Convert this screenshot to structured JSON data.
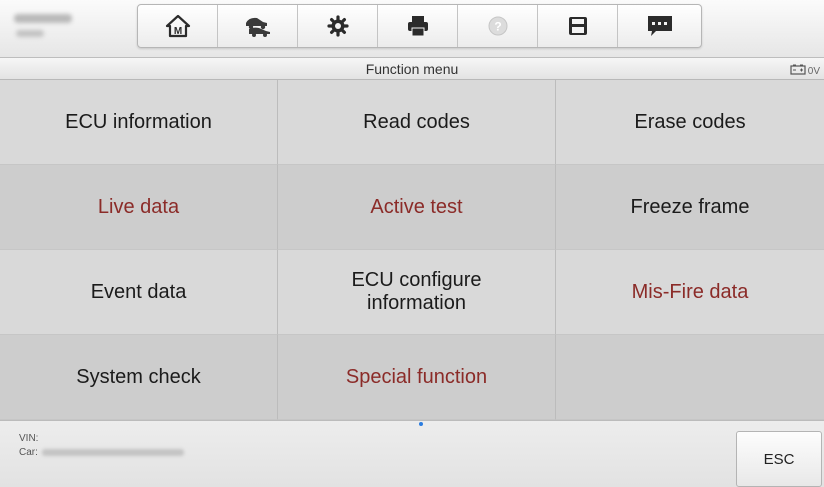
{
  "toolbar": {
    "icons": [
      "home-icon",
      "vehicle-swap-icon",
      "settings-gear-icon",
      "printer-icon",
      "help-icon",
      "save-icon",
      "message-icon"
    ]
  },
  "function_bar": {
    "title": "Function menu",
    "battery_voltage": "0V"
  },
  "menu": {
    "items": [
      {
        "label": "ECU information",
        "color": "#1b1b1b"
      },
      {
        "label": "Read codes",
        "color": "#1b1b1b"
      },
      {
        "label": "Erase codes",
        "color": "#1b1b1b"
      },
      {
        "label": "Live data",
        "color": "#8b2b28"
      },
      {
        "label": "Active test",
        "color": "#8b2b28"
      },
      {
        "label": "Freeze frame",
        "color": "#1b1b1b"
      },
      {
        "label": "Event data",
        "color": "#1b1b1b"
      },
      {
        "label": "ECU configure information",
        "color": "#1b1b1b"
      },
      {
        "label": "Mis-Fire data",
        "color": "#8b2b28"
      },
      {
        "label": "System check",
        "color": "#1b1b1b"
      },
      {
        "label": "Special function",
        "color": "#8b2b28"
      },
      {
        "label": "",
        "color": "#1b1b1b"
      }
    ]
  },
  "footer": {
    "vin_label": "VIN:",
    "car_label": "Car:",
    "esc_label": "ESC"
  }
}
